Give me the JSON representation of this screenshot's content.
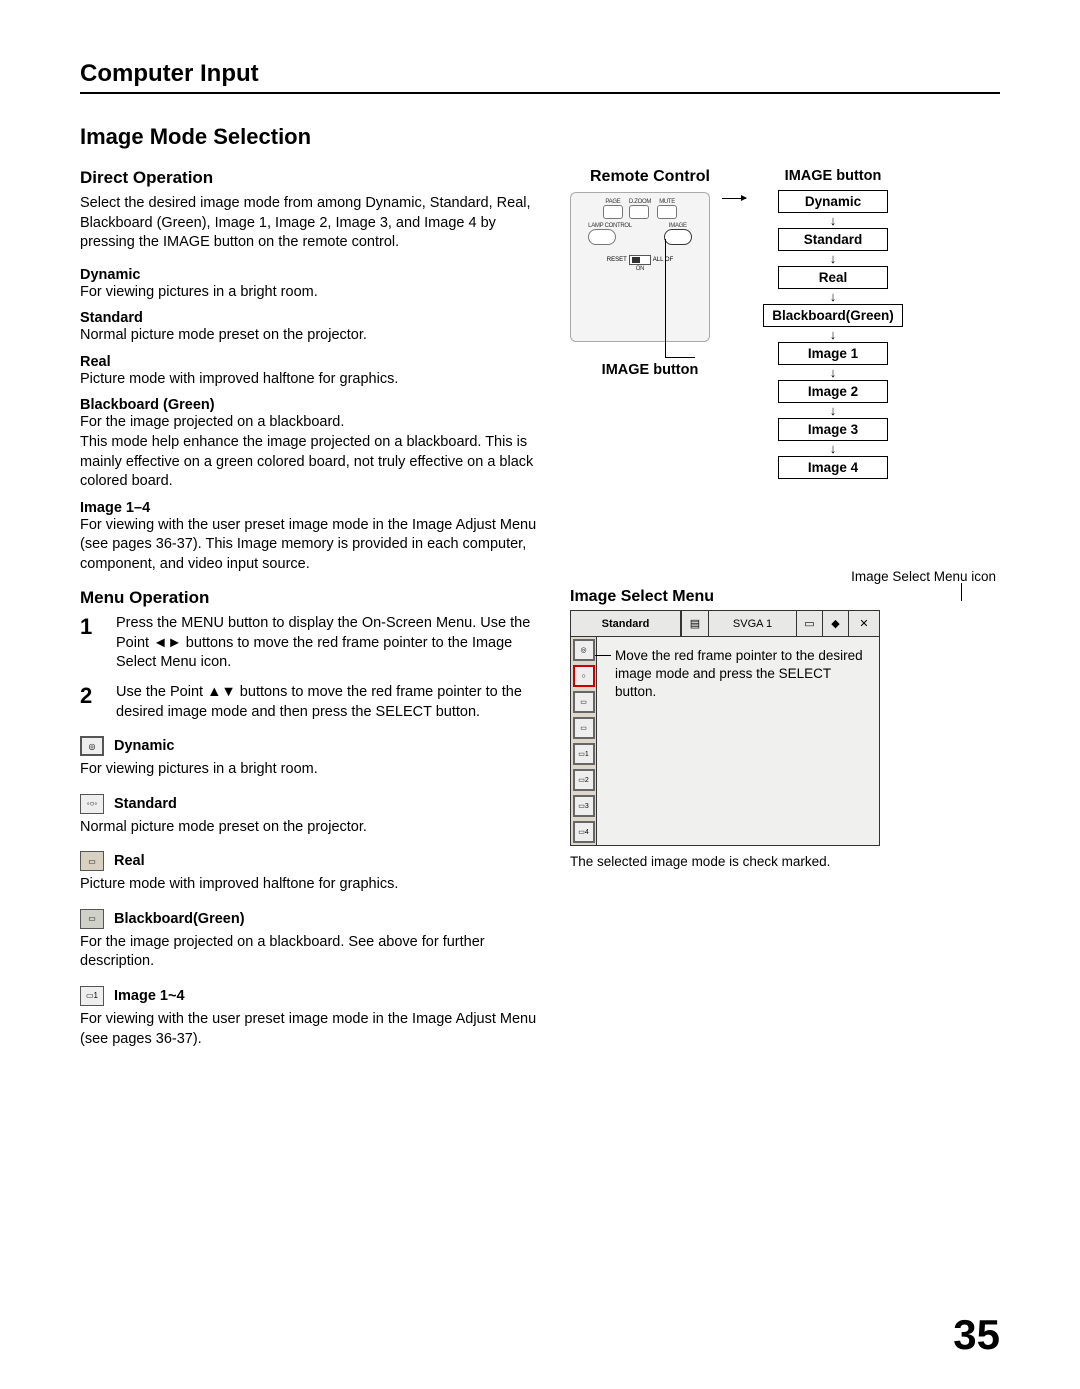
{
  "chapter": "Computer Input",
  "section_title": "Image Mode Selection",
  "direct": {
    "heading": "Direct Operation",
    "intro": "Select the desired image mode from among Dynamic, Standard, Real, Blackboard (Green), Image 1, Image 2, Image 3, and Image 4 by pressing the IMAGE button on the remote control.",
    "items": [
      {
        "term": "Dynamic",
        "desc": "For viewing pictures in a bright room."
      },
      {
        "term": "Standard",
        "desc": "Normal picture mode preset on the projector."
      },
      {
        "term": "Real",
        "desc": "Picture mode with improved halftone for graphics."
      },
      {
        "term": "Blackboard (Green)",
        "desc": "For the image projected on a blackboard.\nThis mode help enhance the image projected on a blackboard. This is mainly effective on a green colored board, not truly effective on a black colored board."
      },
      {
        "term": "Image 1–4",
        "desc": "For viewing with the user preset image mode in the Image Adjust Menu (see pages 36-37). This Image memory is provided in each computer, component, and video input source."
      }
    ]
  },
  "menu_op": {
    "heading": "Menu Operation",
    "steps": [
      {
        "n": "1",
        "t": "Press the MENU button to display the On-Screen Menu. Use the Point ◄► buttons to move the red frame pointer to the Image Select Menu icon."
      },
      {
        "n": "2",
        "t": "Use the Point ▲▼ buttons to move the red frame pointer to the desired image mode and then press the SELECT button."
      }
    ],
    "icon_items": [
      {
        "icon": "dynamic-icon",
        "label": "Dynamic",
        "desc": "For viewing pictures in a bright room."
      },
      {
        "icon": "standard-icon",
        "label": "Standard",
        "desc": "Normal picture mode preset on the projector."
      },
      {
        "icon": "real-icon",
        "label": "Real",
        "desc": "Picture mode with improved halftone for graphics."
      },
      {
        "icon": "blackboard-icon",
        "label": "Blackboard(Green)",
        "desc": "For the image projected on a blackboard. See above for further description."
      },
      {
        "icon": "image14-icon",
        "label": "Image 1~4",
        "desc": "For viewing with the user preset image mode in the Image Adjust Menu (see pages 36-37)."
      }
    ]
  },
  "remote": {
    "title": "Remote Control",
    "labels": {
      "page": "PAGE",
      "dzoom": "D.ZOOM",
      "mute": "MUTE",
      "lamp": "LAMP CONTROL",
      "image": "IMAGE",
      "reset": "RESET",
      "allof": "ALL OF",
      "on": "ON"
    },
    "image_button_label": "IMAGE button"
  },
  "flow": {
    "title": "IMAGE button",
    "boxes": [
      "Dynamic",
      "Standard",
      "Real",
      "Blackboard(Green)",
      "Image 1",
      "Image 2",
      "Image 3",
      "Image 4"
    ]
  },
  "menu_diag": {
    "caption_top": "Image Select Menu icon",
    "title": "Image Select Menu",
    "topbar": {
      "mode": "Standard",
      "signal": "SVGA 1"
    },
    "note": "Move the red frame pointer to the desired image mode and press the SELECT button.",
    "caption_bot": "The selected image mode is check marked."
  },
  "page_number": "35"
}
